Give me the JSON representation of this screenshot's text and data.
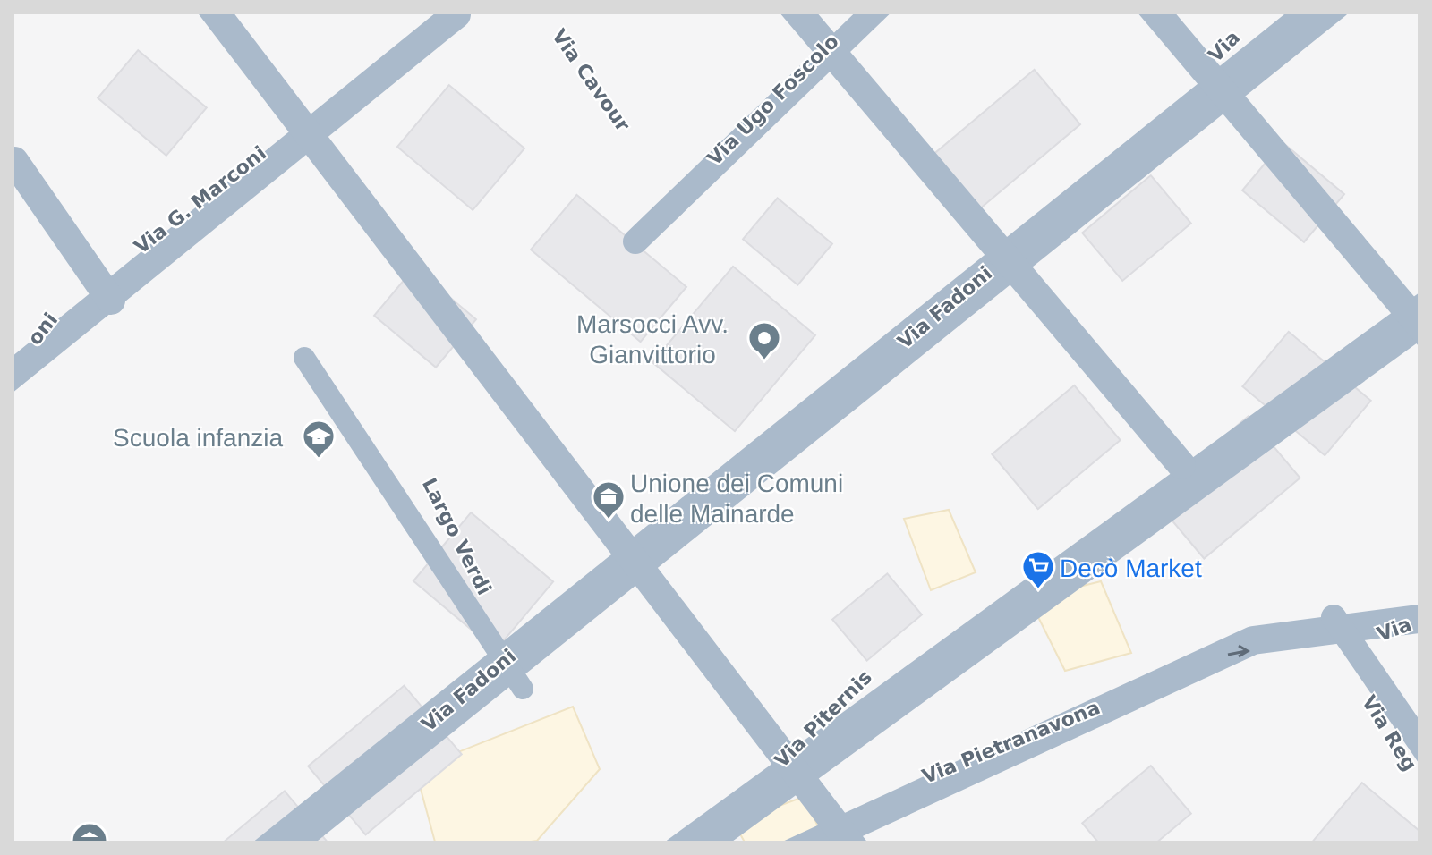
{
  "map": {
    "streets": [
      {
        "name": "Via G. Marconi"
      },
      {
        "name": "oni"
      },
      {
        "name": "Via Cavour"
      },
      {
        "name": "Via Ugo Foscolo"
      },
      {
        "name": "Via"
      },
      {
        "name": "Via Fadoni"
      },
      {
        "name": "Via Fadoni"
      },
      {
        "name": "Largo Verdi"
      },
      {
        "name": "Via Piternis"
      },
      {
        "name": "Via Pietranavona"
      },
      {
        "name": "Via"
      },
      {
        "name": "Via Reg"
      }
    ],
    "places": [
      {
        "lines": [
          "Marsocci Avv.",
          "Gianvittorio"
        ],
        "kind": "pin",
        "color": "#6b7f8c"
      },
      {
        "lines": [
          "Scuola infanzia"
        ],
        "kind": "school",
        "color": "#6b7f8c"
      },
      {
        "lines": [
          "Unione dei Comuni",
          "delle Mainarde"
        ],
        "kind": "government",
        "color": "#6b7f8c"
      },
      {
        "lines": [
          "Decò Market"
        ],
        "kind": "shop",
        "color": "#1a73e8"
      }
    ]
  }
}
